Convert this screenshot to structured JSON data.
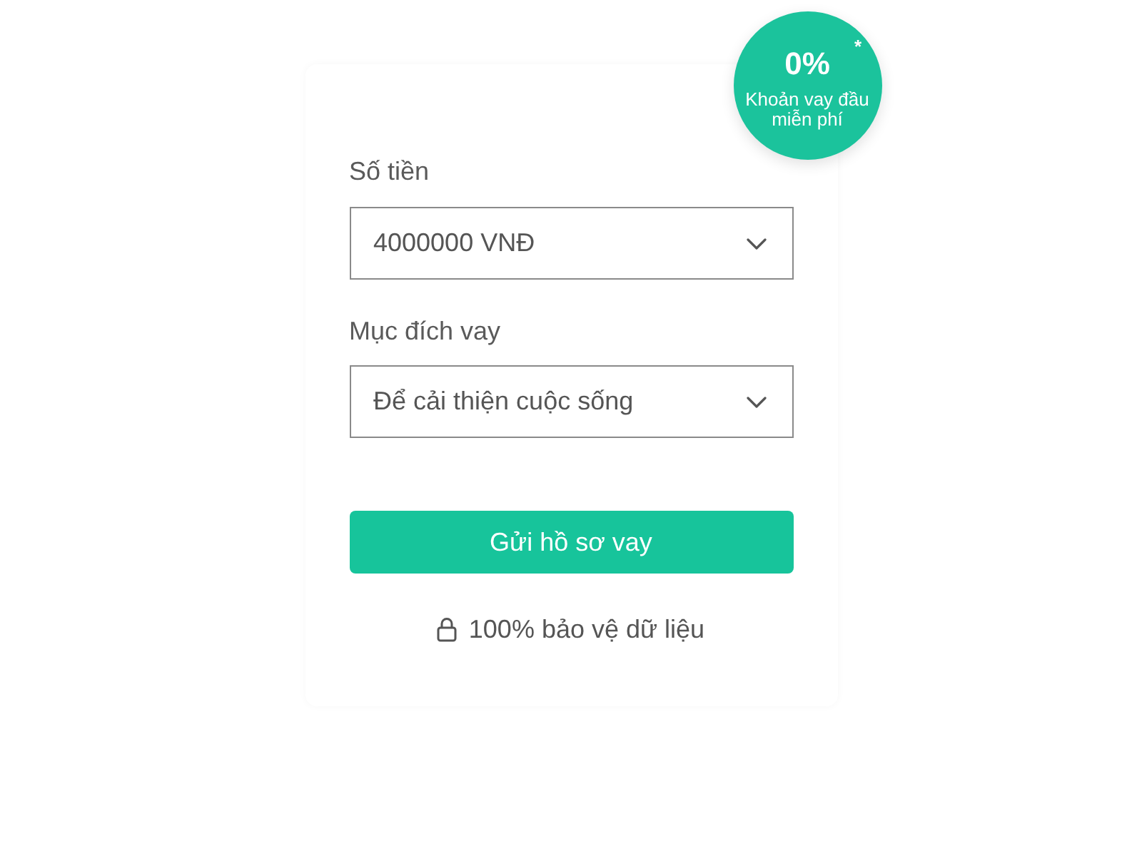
{
  "badge": {
    "value": "0%",
    "mark": "*",
    "text": "Khoản vay đầu miễn phí"
  },
  "fields": [
    {
      "label": "Số tiền",
      "value": "4000000 VNĐ"
    },
    {
      "label": "Mục đích vay",
      "value": "Để cải thiện cuộc sống"
    }
  ],
  "submit_button": "Gửi hồ sơ vay",
  "security_note": "100% bảo vệ dữ liệu"
}
